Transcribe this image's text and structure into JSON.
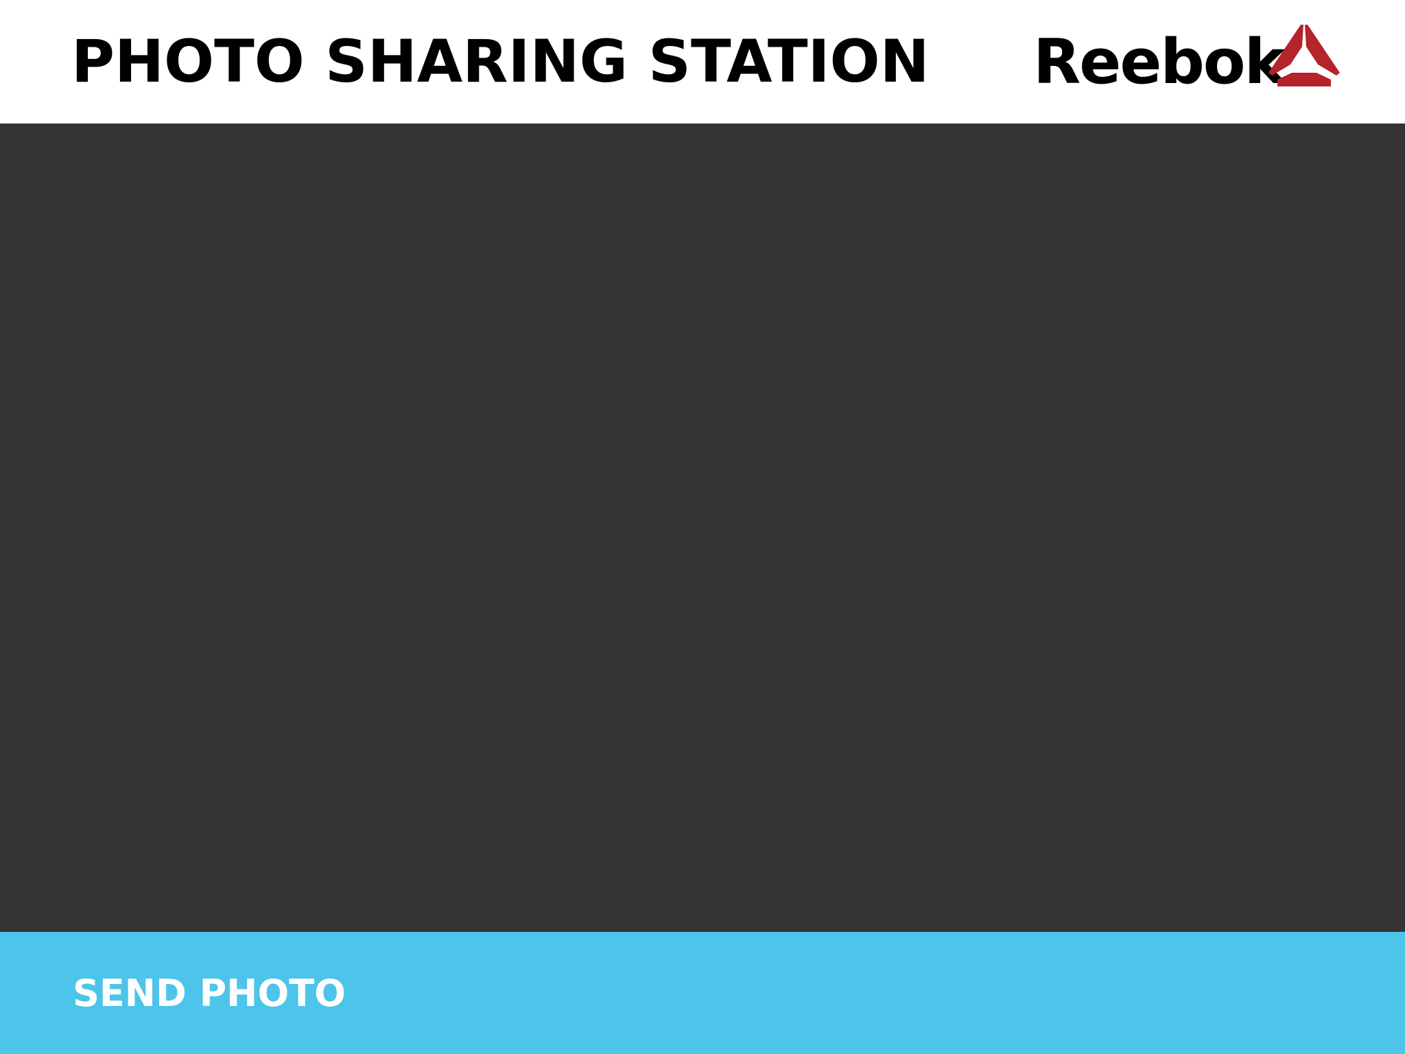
{
  "header": {
    "title": "PHOTO SHARING STATION",
    "brand_name": "Reebok",
    "brand_icon": "reebok-delta-logo-icon"
  },
  "main": {
    "photo_preview": ""
  },
  "footer": {
    "send_label": "SEND PHOTO"
  },
  "colors": {
    "header_background": "#ffffff",
    "title_text": "#000000",
    "photo_background": "#333333",
    "footer_background": "#4dc4ea",
    "footer_text": "#ffffff",
    "logo_accent": "#b5232b"
  }
}
